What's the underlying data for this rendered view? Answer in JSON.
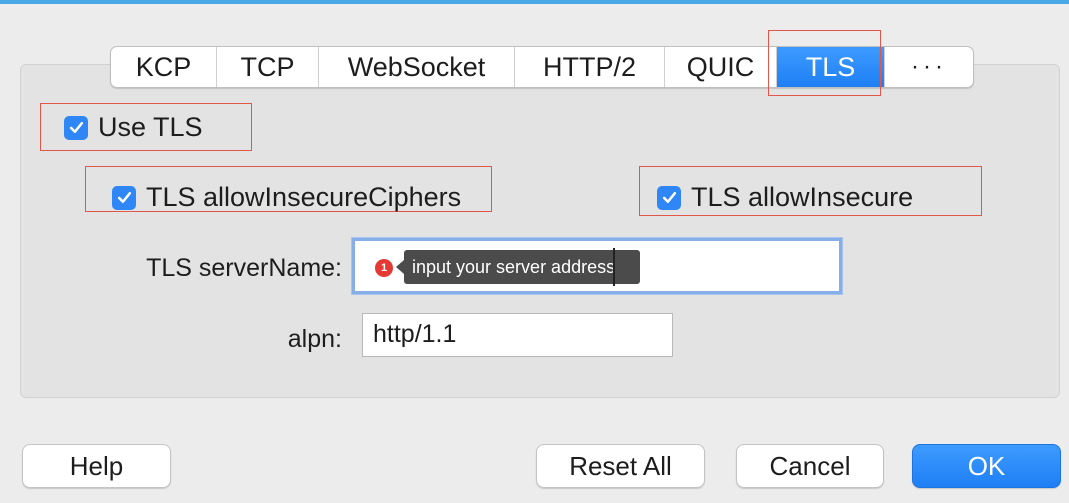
{
  "tabs": [
    "KCP",
    "TCP",
    "WebSocket",
    "HTTP/2",
    "QUIC",
    "TLS",
    "···"
  ],
  "active_tab": "TLS",
  "options": {
    "use_tls": {
      "label": "Use TLS",
      "checked": true
    },
    "allow_insecure_ciphers": {
      "label": "TLS allowInsecureCiphers",
      "checked": true
    },
    "allow_insecure": {
      "label": "TLS allowInsecure",
      "checked": true
    }
  },
  "server_name": {
    "label": "TLS serverName:",
    "value": "",
    "tooltip": "input your server address",
    "badge": "1"
  },
  "alpn": {
    "label": "alpn:",
    "value": "http/1.1"
  },
  "buttons": {
    "help": "Help",
    "reset_all": "Reset All",
    "cancel": "Cancel",
    "ok": "OK"
  },
  "colors": {
    "accent": "#2f87f7",
    "highlight": "#e2574c",
    "tooltip_bg": "#4b4b4b"
  }
}
